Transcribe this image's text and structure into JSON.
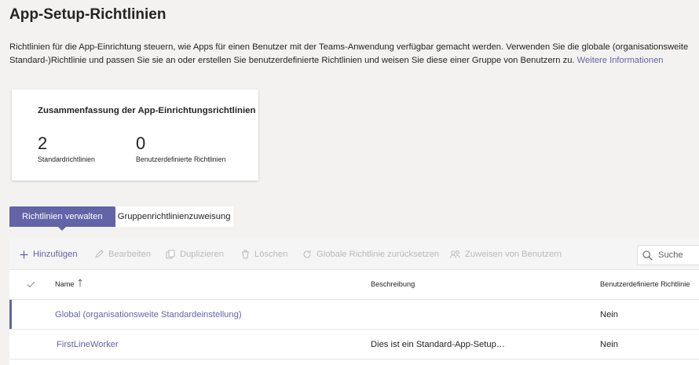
{
  "page": {
    "title": "App-Setup-Richtlinien",
    "description": "Richtlinien für die App-Einrichtung steuern, wie Apps für einen Benutzer mit der Teams-Anwendung verfügbar gemacht werden. Verwenden Sie die globale (organisationsweite Standard-)Richtlinie und passen Sie sie an oder erstellen Sie benutzerdefinierte Richtlinien und weisen Sie diese einer Gruppe von Benutzern zu.",
    "learn_more": "Weitere Informationen"
  },
  "summary": {
    "title": "Zusammenfassung der App-Einrichtungsrichtlinien",
    "stats": [
      {
        "value": "2",
        "label": "Standardrichtlinien"
      },
      {
        "value": "0",
        "label": "Benutzerdefinierte Richtlinien"
      }
    ]
  },
  "tabs": [
    {
      "label": "Richtlinien verwalten",
      "active": true
    },
    {
      "label": "Gruppenrichtlinienzuweisung",
      "active": false
    }
  ],
  "toolbar": {
    "add": "Hinzufügen",
    "edit": "Bearbeiten",
    "duplicate": "Duplizieren",
    "delete": "Löschen",
    "reset_global": "Globale Richtlinie zurücksetzen",
    "assign": "Zuweisen von Benutzern",
    "search_placeholder": "Suche"
  },
  "table": {
    "columns": [
      "Name",
      "Beschreibung",
      "Benutzerdefinierte Richtlinie"
    ],
    "rows": [
      {
        "name": "Global (organisationsweite Standardeinstellung)",
        "description": "",
        "custom": "Nein",
        "selected": true
      },
      {
        "name": "FirstLineWorker",
        "description": "Dies ist ein Standard-App-Setup…",
        "custom": "Nein",
        "selected": false
      }
    ]
  },
  "colors": {
    "accent": "#6264a7",
    "background": "#f3f2f1",
    "disabled": "#b9b9b9"
  }
}
